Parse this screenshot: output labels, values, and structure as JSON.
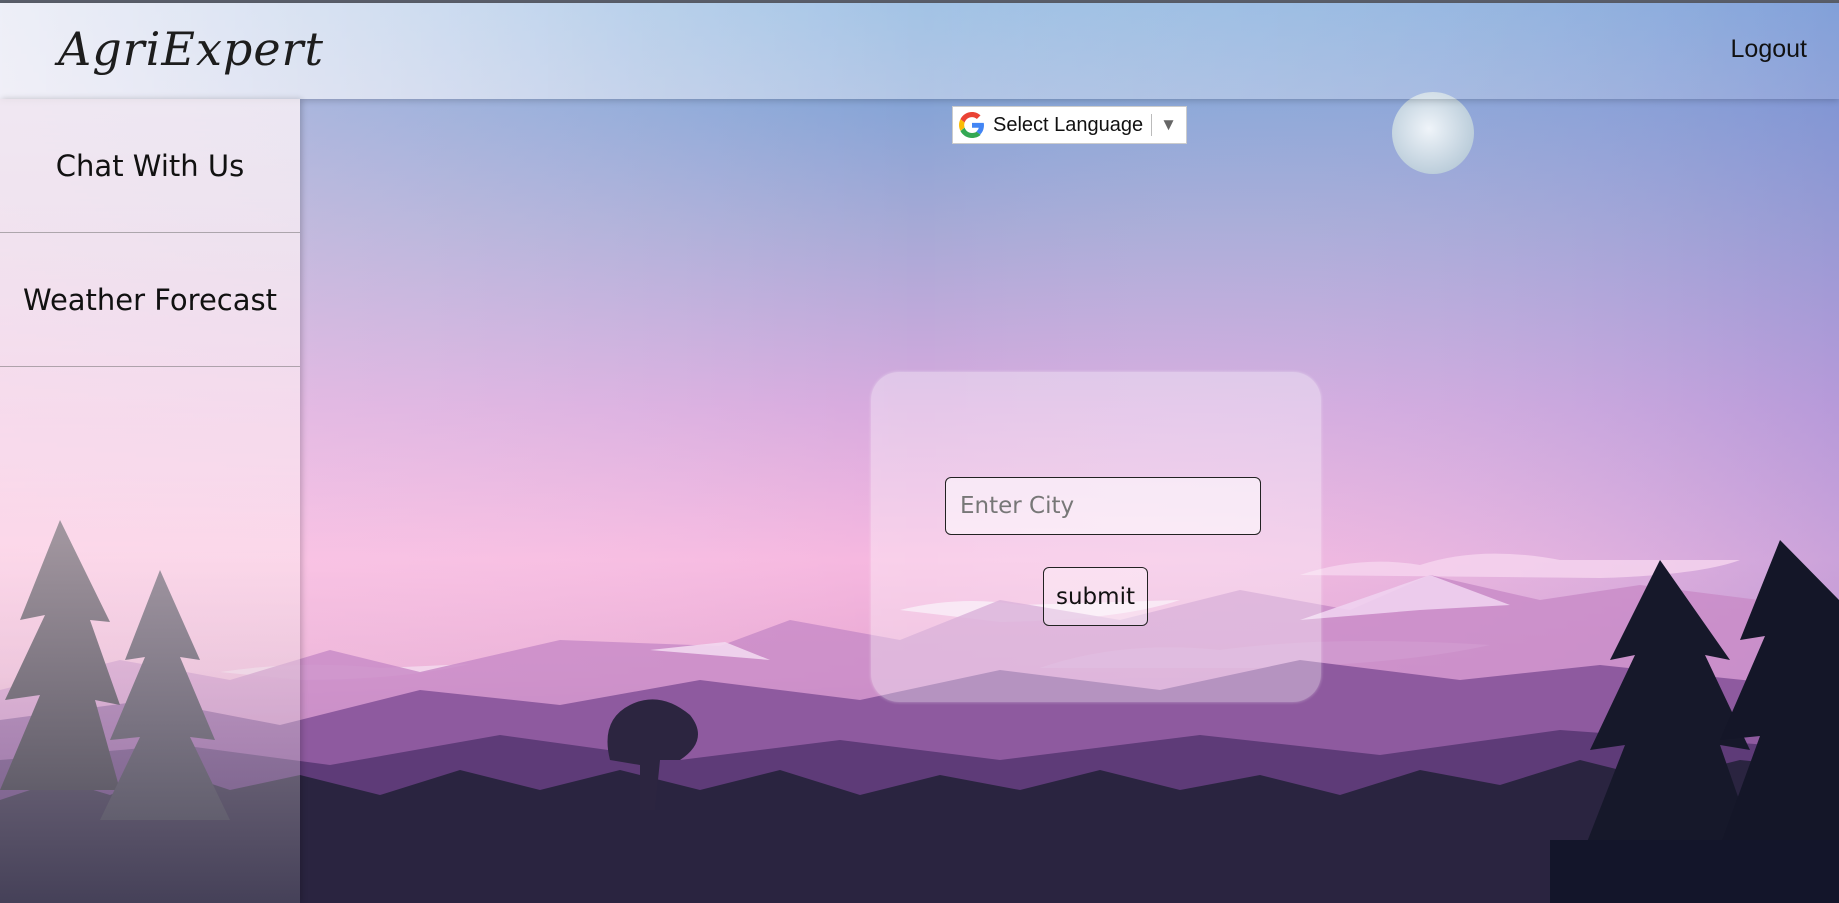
{
  "header": {
    "logo_text": "AgriExpert",
    "logout_label": "Logout"
  },
  "sidebar": {
    "items": [
      {
        "label": "Chat With Us"
      },
      {
        "label": "Weather Forecast"
      }
    ]
  },
  "translate": {
    "label": "Select Language",
    "caret": "▼"
  },
  "weather_form": {
    "city_placeholder": "Enter City",
    "city_value": "",
    "submit_label": "submit"
  },
  "colors": {
    "sky_top": "#6a9fd6",
    "sky_mid": "#c9a2d8",
    "sky_pink": "#f7b6dc",
    "mountain_far": "#b78ac6",
    "mountain_mid": "#7e4f97",
    "forest_dark": "#1f1e33"
  }
}
